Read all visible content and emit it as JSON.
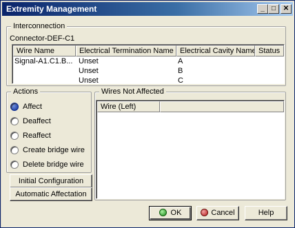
{
  "window": {
    "title": "Extremity Management",
    "controls": {
      "minimize": "_",
      "maximize": "□",
      "close": "✕"
    }
  },
  "interconnection": {
    "group_label": "Interconnection",
    "connector_name": "Connector-DEF-C1",
    "columns": [
      "Wire Name",
      "Electrical Termination Name",
      "Electrical Cavity Name",
      "Status"
    ],
    "rows": [
      [
        "Signal-A1.C1.B...",
        "Unset",
        "A",
        ""
      ],
      [
        "",
        "Unset",
        "B",
        ""
      ],
      [
        "",
        "Unset",
        "C",
        ""
      ]
    ]
  },
  "actions": {
    "group_label": "Actions",
    "options": [
      {
        "label": "Affect",
        "checked": true
      },
      {
        "label": "Deaffect",
        "checked": false
      },
      {
        "label": "Reaffect",
        "checked": false
      },
      {
        "label": "Create bridge wire",
        "checked": false
      },
      {
        "label": "Delete bridge wire",
        "checked": false
      }
    ],
    "initial_configuration": "Initial Configuration",
    "automatic_affectation": "Automatic Affectation"
  },
  "wires_not_affected": {
    "group_label": "Wires Not Affected",
    "columns": [
      "Wire (Left)",
      ""
    ]
  },
  "footer": {
    "ok": "OK",
    "cancel": "Cancel",
    "help": "Help"
  },
  "colors": {
    "titlebar_start": "#0a246a",
    "titlebar_end": "#a6caf0",
    "dialog_bg": "#ece9d8",
    "ok_icon": "#1a8a1a",
    "cancel_icon": "#b81c1c"
  },
  "icons": {
    "ok": "green-circle-icon",
    "cancel": "red-circle-icon"
  }
}
